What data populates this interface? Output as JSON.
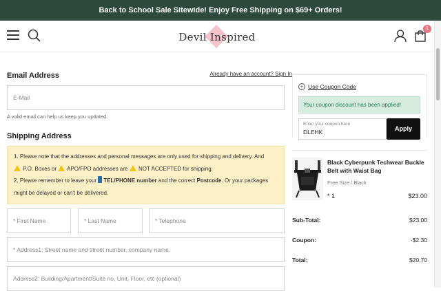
{
  "banner": {
    "text": "Back to School Sale Sitewide! Enjoy Free Shipping on $69+ Orders!"
  },
  "header": {
    "logo_text": "Devil Inspired",
    "cart_count": "1"
  },
  "email_section": {
    "title": "Email Address",
    "signin_link": "Already have an account? Sign In",
    "email_placeholder": "E-Mail",
    "hint": "A valid email can help us keep you updated."
  },
  "shipping_section": {
    "title": "Shipping Address",
    "notice": {
      "line1": "1. Please note that the addresses and personal messages are only used for shipping and delivery. And",
      "line2_a": "P.O. Boxes or",
      "line2_b": "APO/FPO addresses are",
      "line2_c": "NOT ACCEPTED for shipping.",
      "line3_a": "2. Please remember to leave your",
      "line3_b": "TEL/PHONE number",
      "line3_c": "and the correct",
      "line3_d": "Postcode",
      "line3_e": ". Or your packages",
      "line4": "might be delayed or can't be delivered."
    },
    "first_name_placeholder": "* First Name",
    "last_name_placeholder": "* Last Name",
    "telephone_placeholder": "* Telephone",
    "address1_placeholder": "* Address1: Street name and street number, company name.",
    "address2_placeholder": "Address2: Building/Apartment/Suite no, Unit, Floor, etc (optional)"
  },
  "coupon": {
    "link_label": "Use Coupon Code",
    "success_message": "Your coupon discount has been applied!",
    "input_placeholder": "Enter your coupon here",
    "input_value": "DLEHK",
    "apply_label": "Apply"
  },
  "product": {
    "name": "Black Cyberpunk Techwear Buckle Belt with Waist Bag",
    "variant": "Free Size  /  Black",
    "quantity": "* 1",
    "price": "$23.00"
  },
  "summary": [
    {
      "label": "Sub-Total:",
      "value": "$23.00"
    },
    {
      "label": "Coupon:",
      "value": "-$2.30"
    },
    {
      "label": "Total:",
      "value": "$20.70"
    }
  ]
}
